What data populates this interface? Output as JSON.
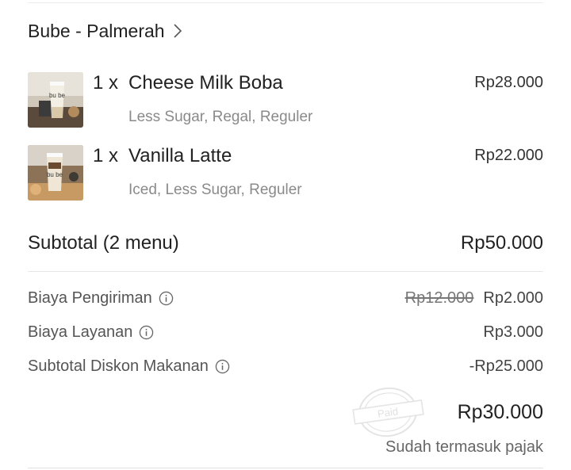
{
  "store": {
    "name": "Bube - Palmerah"
  },
  "items": [
    {
      "qty": "1 x",
      "name": "Cheese Milk Boba",
      "options": "Less Sugar, Regal, Reguler",
      "price": "Rp28.000",
      "cup_text": "bu be"
    },
    {
      "qty": "1 x",
      "name": "Vanilla Latte",
      "options": "Iced, Less Sugar, Reguler",
      "price": "Rp22.000",
      "cup_text": "bu be"
    }
  ],
  "subtotal": {
    "label": "Subtotal (2 menu)",
    "value": "Rp50.000"
  },
  "fees": {
    "delivery": {
      "label": "Biaya Pengiriman",
      "original": "Rp12.000",
      "value": "Rp2.000",
      "icon": "info-icon"
    },
    "service": {
      "label": "Biaya Layanan",
      "value": "Rp3.000",
      "icon": "info-icon"
    },
    "discount": {
      "label": "Subtotal Diskon Makanan",
      "value": "-Rp25.000",
      "icon": "info-icon"
    }
  },
  "total": {
    "value": "Rp30.000",
    "stamp_text": "Paid",
    "tax_note": "Sudah termasuk pajak"
  },
  "colors": {
    "text": "#222222",
    "muted": "#8a8a8a",
    "divider": "#e6e6e6"
  }
}
